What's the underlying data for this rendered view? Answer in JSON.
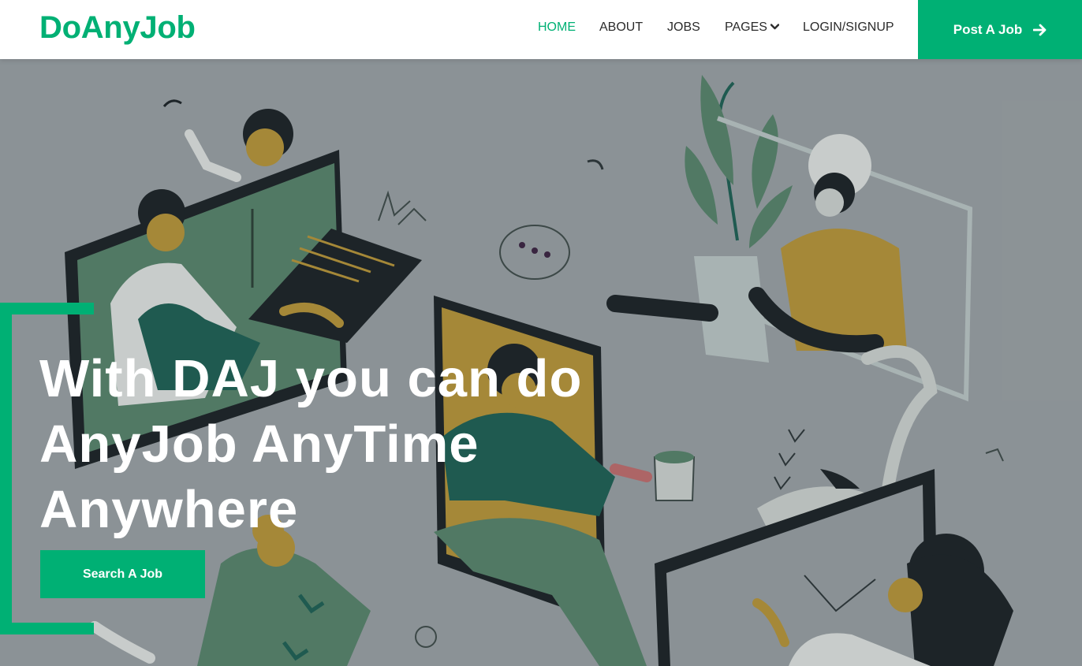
{
  "brand": {
    "name": "DoAnyJob"
  },
  "nav": {
    "items": [
      {
        "label": "HOME",
        "active": true
      },
      {
        "label": "ABOUT"
      },
      {
        "label": "JOBS"
      },
      {
        "label": "PAGES",
        "has_dropdown": true
      },
      {
        "label": "LOGIN/SIGNUP"
      }
    ]
  },
  "post_job": {
    "label": "Post A Job",
    "icon": "arrow-right-icon"
  },
  "hero": {
    "headline_lines": [
      "With DAJ you can do",
      "AnyJob AnyTime",
      "Anywhere"
    ],
    "cta_label": "Search A Job",
    "illustration": "people-working-remotely-illustration"
  },
  "colors": {
    "accent": "#00b074",
    "text": "#2b2b2b",
    "hero_bg": "#939a9d"
  }
}
